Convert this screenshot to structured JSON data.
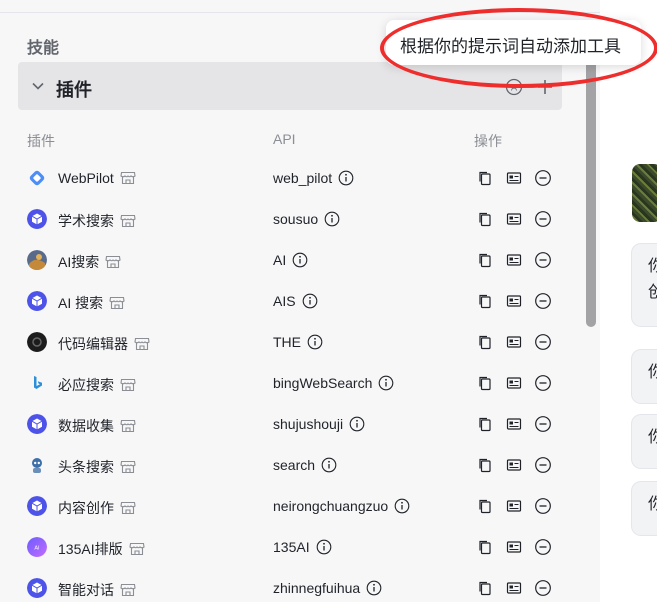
{
  "section_title": "技能",
  "plugin_section": {
    "title": "插件"
  },
  "columns": {
    "plugin": "插件",
    "api": "API",
    "ops": "操作"
  },
  "tooltip": "根据你的提示词自动添加工具",
  "rows": [
    {
      "name": "WebPilot",
      "api": "web_pilot",
      "logo": "webpilot"
    },
    {
      "name": "学术搜索",
      "api": "sousuo",
      "logo": "cube"
    },
    {
      "name": "AI搜索",
      "api": "AI",
      "logo": "photo"
    },
    {
      "name": "AI 搜索",
      "api": "AIS",
      "logo": "cube"
    },
    {
      "name": "代码编辑器",
      "api": "THE",
      "logo": "dark"
    },
    {
      "name": "必应搜索",
      "api": "bingWebSearch",
      "logo": "bing"
    },
    {
      "name": "数据收集",
      "api": "shujushouji",
      "logo": "cube"
    },
    {
      "name": "头条搜索",
      "api": "search",
      "logo": "robot"
    },
    {
      "name": "内容创作",
      "api": "neirongchuangzuo",
      "logo": "cube"
    },
    {
      "name": "135AI排版",
      "api": "135AI",
      "logo": "ai135"
    },
    {
      "name": "智能对话",
      "api": "zhinnegfuihua",
      "logo": "cube"
    }
  ],
  "right_bubbles": [
    "你\n创",
    "你",
    "你",
    "你"
  ],
  "colors": {
    "accent": "#4d53e8",
    "highlight": "#ee2d2d"
  }
}
